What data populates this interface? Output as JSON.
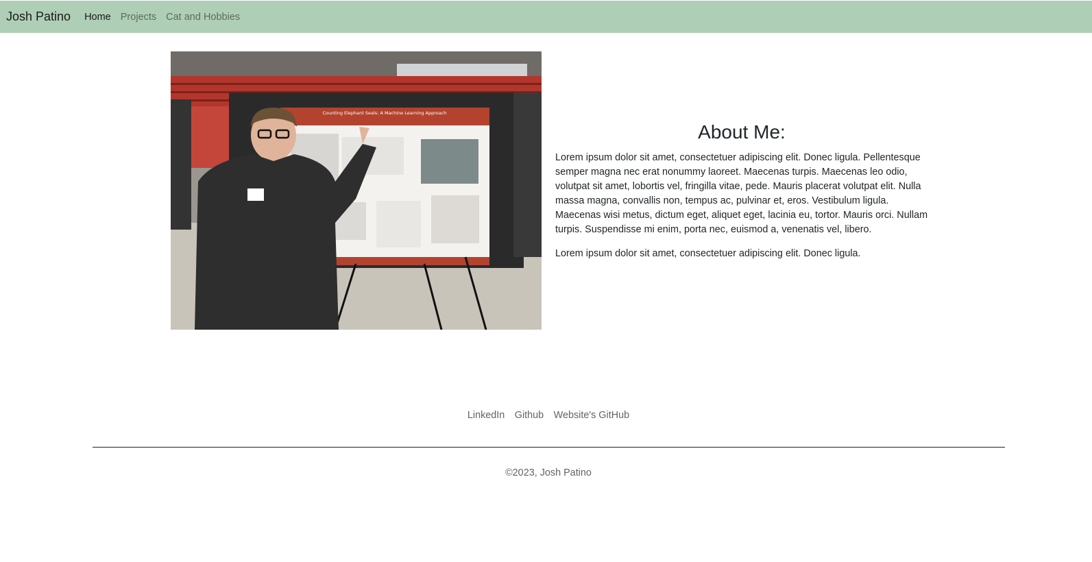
{
  "navbar": {
    "brand": "Josh Patino",
    "links": [
      "Home",
      "Projects",
      "Cat and Hobbies"
    ],
    "active": "Home",
    "background": "#aecfb5"
  },
  "photo": {
    "poster_title": "Counting Elephant Seals: A Machine Learning Approach"
  },
  "about": {
    "heading": "About Me:",
    "paragraphs": [
      "Lorem ipsum dolor sit amet, consectetuer adipiscing elit. Donec ligula. Pellentesque semper magna nec erat nonummy laoreet. Maecenas turpis. Maecenas leo odio, volutpat sit amet, lobortis vel, fringilla vitae, pede. Mauris placerat volutpat elit. Nulla massa magna, convallis non, tempus ac, pulvinar et, eros. Vestibulum ligula. Maecenas wisi metus, dictum eget, aliquet eget, lacinia eu, tortor. Mauris orci. Nullam turpis. Suspendisse mi enim, porta nec, euismod a, venenatis vel, libero.",
      "Lorem ipsum dolor sit amet, consectetuer adipiscing elit. Donec ligula."
    ]
  },
  "footer": {
    "links": [
      "LinkedIn",
      "Github",
      "Website's GitHub"
    ],
    "copyright": "©2023, Josh Patino"
  }
}
